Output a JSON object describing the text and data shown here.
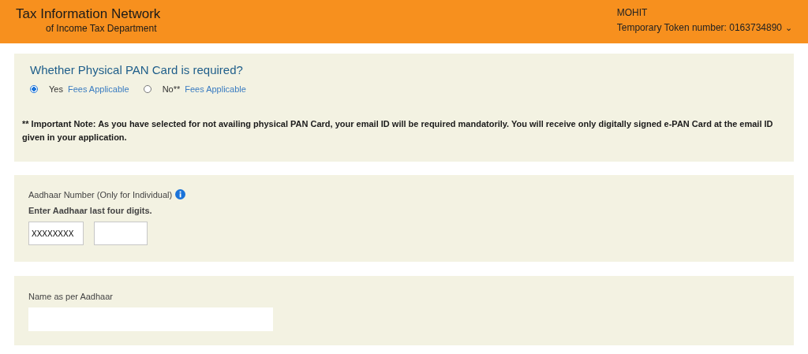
{
  "header": {
    "title": "Tax Information Network",
    "subtitle": "of Income Tax Department",
    "user": "MOHIT",
    "token": "Temporary Token number: 0163734890",
    "caret": "⌄"
  },
  "pan_card": {
    "question": "Whether Physical PAN Card is required?",
    "options": [
      {
        "label": "Yes",
        "link": "Fees Applicable",
        "selected": true
      },
      {
        "label": "No**",
        "link": "Fees Applicable",
        "selected": false
      }
    ],
    "note": "** Important Note: As you have selected for not availing physical PAN Card, your email ID will be required mandatorily. You will receive only digitally signed e-PAN Card at the email ID given in your application."
  },
  "aadhaar": {
    "label": "Aadhaar Number (Only for Individual)",
    "instruction": "Enter Aadhaar last four digits.",
    "masked": "XXXXXXXX"
  },
  "name": {
    "label": "Name as per Aadhaar"
  }
}
